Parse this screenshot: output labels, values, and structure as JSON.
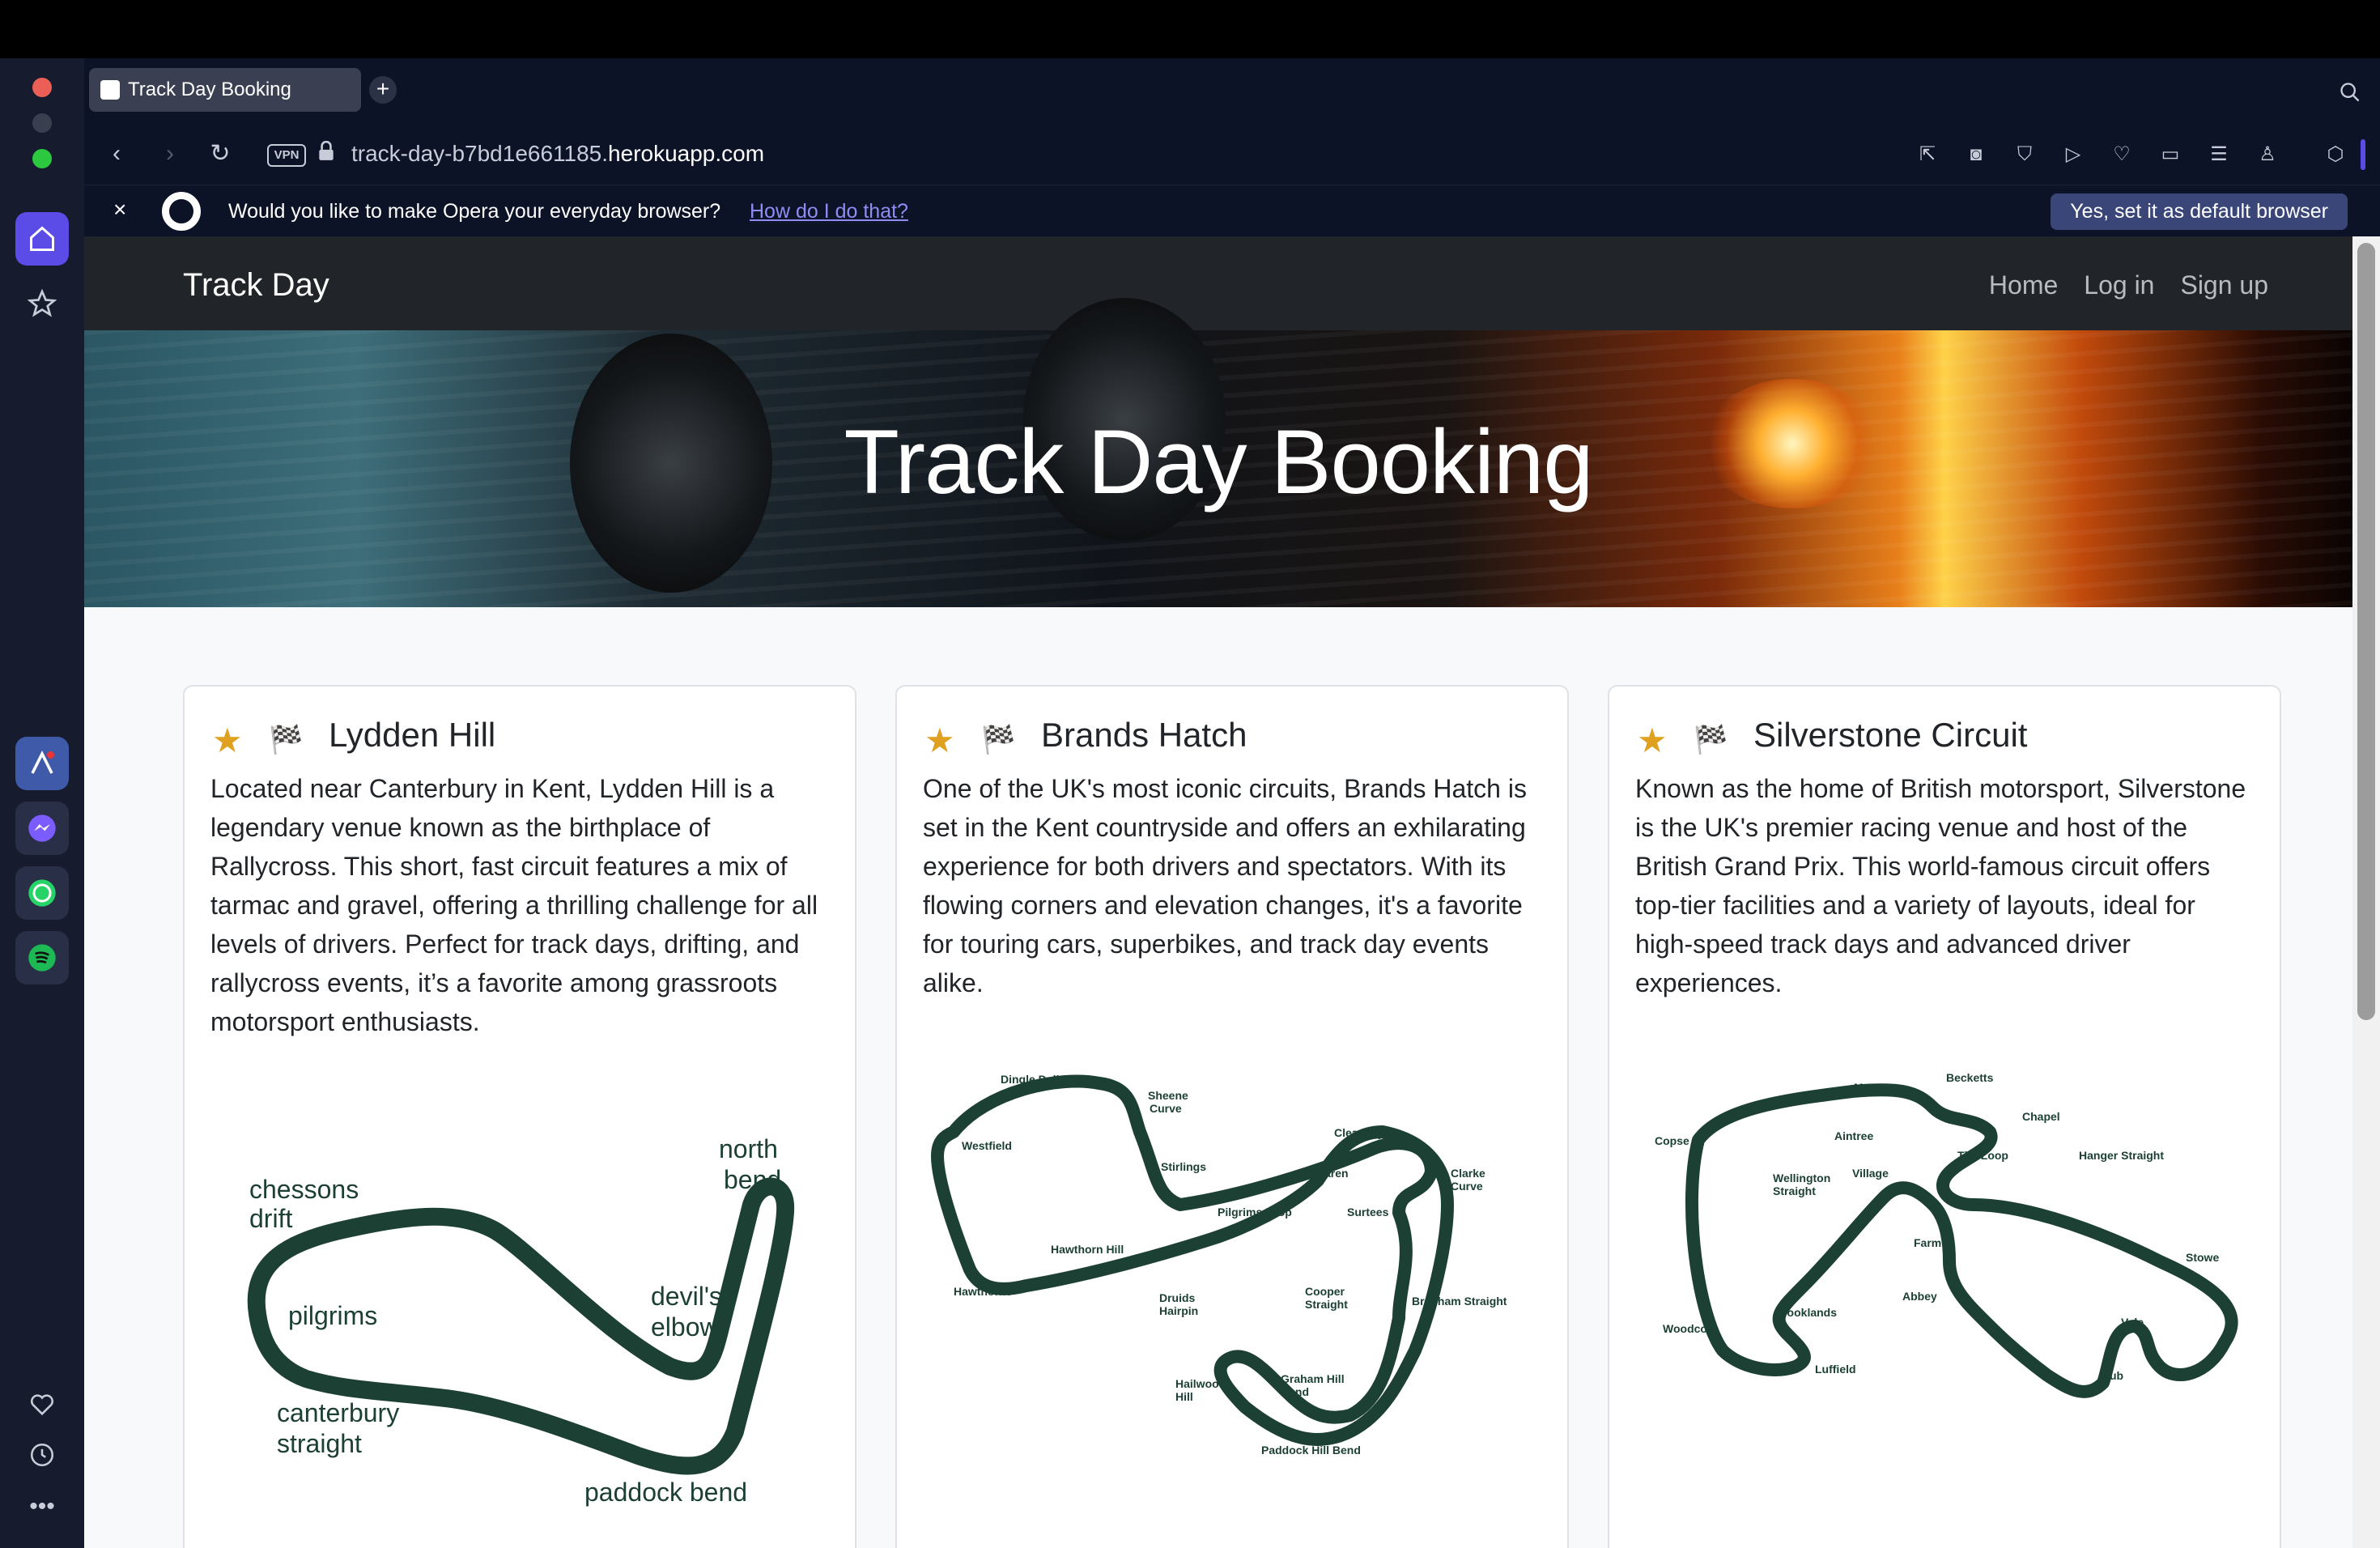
{
  "browser": {
    "tab_title": "Track Day Booking",
    "url_prefix": "track-day-b7bd1e661185.",
    "url_domain": "herokuapp.com",
    "vpn_label": "VPN"
  },
  "banner": {
    "close": "×",
    "message": "Would you like to make Opera your everyday browser?",
    "link": "How do I do that?",
    "cta": "Yes, set it as default browser"
  },
  "site": {
    "brand": "Track Day",
    "nav": [
      "Home",
      "Log in",
      "Sign up"
    ],
    "hero_title": "Track Day Booking"
  },
  "cards": [
    {
      "title": "Lydden Hill",
      "description": "Located near Canterbury in Kent, Lydden Hill is a legendary venue known as the birthplace of Rallycross. This short, fast circuit features a mix of tarmac and gravel, offering a thrilling challenge for all levels of drivers. Perfect for track days, drifting, and rallycross events, it’s a favorite among grassroots motorsport enthusiasts.",
      "map_labels": [
        "north",
        "bend",
        "chessons",
        "drift",
        "pilgrims",
        "devil's",
        "elbow",
        "canterbury",
        "straight",
        "paddock bend"
      ]
    },
    {
      "title": "Brands Hatch",
      "description": "One of the UK's most iconic circuits, Brands Hatch is set in the Kent countryside and offers an exhilarating experience for both drivers and spectators. With its flowing corners and elevation changes, it's a favorite for touring cars, superbikes, and track day events alike.",
      "map_labels": [
        "Dingle Dell",
        "Sheene",
        "Curve",
        "Westfield",
        "Stirlings",
        "Clearways",
        "McLaren",
        "Clarke",
        "Curve",
        "Pilgrims Drop",
        "Surtees",
        "Hawthorn Hill",
        "Hawthorns",
        "Druids",
        "Hairpin",
        "Cooper",
        "Straight",
        "Brabham Straight",
        "Hailwoods",
        "Hill",
        "Graham Hill",
        "Bend",
        "Paddock Hill Bend"
      ]
    },
    {
      "title": "Silverstone Circuit",
      "description": "Known as the home of British motorsport, Silverstone is the UK's premier racing venue and host of the British Grand Prix. This world-famous circuit offers top-tier facilities and a variety of layouts, ideal for high-speed track days and advanced driver experiences.",
      "map_labels": [
        "Maggotts",
        "Becketts",
        "Chapel",
        "Copse",
        "Aintree",
        "The Loop",
        "Hanger Straight",
        "Wellington",
        "Straight",
        "Village",
        "Stowe",
        "Farm",
        "Abbey",
        "Brooklands",
        "Vale",
        "Woodcote",
        "Luffield",
        "Club"
      ]
    }
  ],
  "icons": {
    "star": "★",
    "flags": "🏁"
  }
}
